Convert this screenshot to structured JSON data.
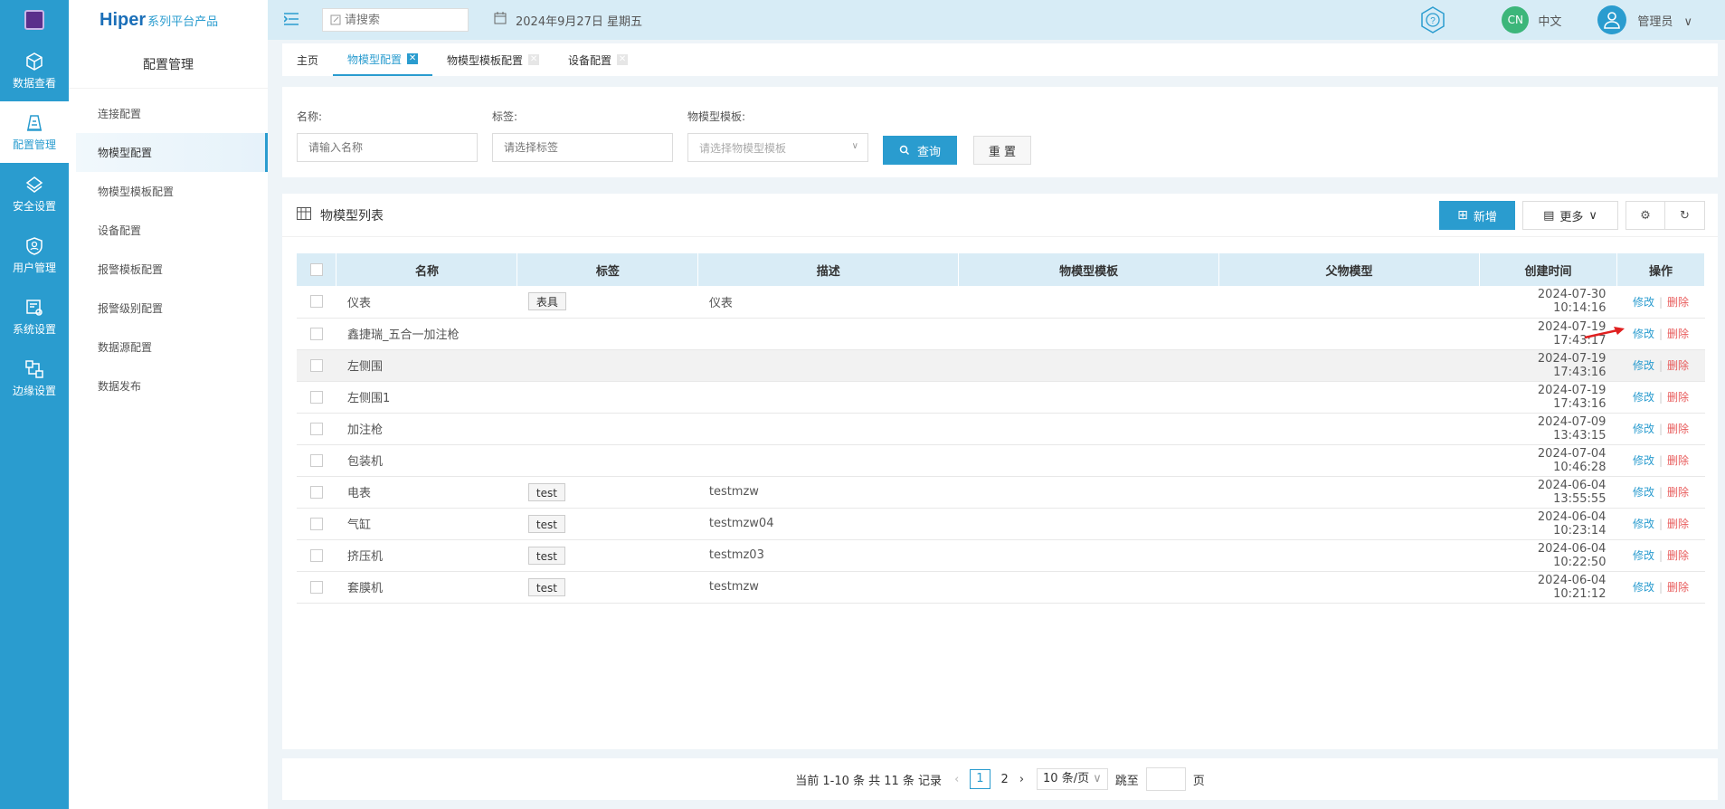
{
  "brand": {
    "name": "Hiper",
    "suffix": "系列平台产品"
  },
  "rail": [
    {
      "label": "数据查看",
      "icon": "cube-icon"
    },
    {
      "label": "配置管理",
      "icon": "config-icon"
    },
    {
      "label": "安全设置",
      "icon": "security-icon"
    },
    {
      "label": "用户管理",
      "icon": "user-shield-icon"
    },
    {
      "label": "系统设置",
      "icon": "system-settings-icon"
    },
    {
      "label": "边缘设置",
      "icon": "edge-icon"
    }
  ],
  "submenu": {
    "title": "配置管理",
    "items": [
      "连接配置",
      "物模型配置",
      "物模型模板配置",
      "设备配置",
      "报警模板配置",
      "报警级别配置",
      "数据源配置",
      "数据发布"
    ]
  },
  "topbar": {
    "search_placeholder": "请搜索",
    "date": "2024年9月27日 星期五",
    "lang_badge": "CN",
    "lang_text": "中文",
    "user": "管理员"
  },
  "tabs": [
    "主页",
    "物模型配置",
    "物模型模板配置",
    "设备配置"
  ],
  "filter": {
    "name_label": "名称:",
    "name_placeholder": "请输入名称",
    "tag_label": "标签:",
    "tag_placeholder": "请选择标签",
    "template_label": "物模型模板:",
    "template_placeholder": "请选择物模型模板",
    "query": "查询",
    "reset": "重 置"
  },
  "list": {
    "title": "物模型列表",
    "add": "新增",
    "more": "更多",
    "columns": [
      "名称",
      "标签",
      "描述",
      "物模型模板",
      "父物模型",
      "创建时间",
      "操作"
    ],
    "edit": "修改",
    "delete": "删除",
    "rows": [
      {
        "name": "仪表",
        "tag": "表具",
        "desc": "仪表",
        "template": "",
        "parent": "",
        "time": "2024-07-30 10:14:16"
      },
      {
        "name": "鑫捷瑞_五合一加注枪",
        "tag": "",
        "desc": "",
        "template": "",
        "parent": "",
        "time": "2024-07-19 17:43:17"
      },
      {
        "name": "左侧围",
        "tag": "",
        "desc": "",
        "template": "",
        "parent": "",
        "time": "2024-07-19 17:43:16"
      },
      {
        "name": "左侧围1",
        "tag": "",
        "desc": "",
        "template": "",
        "parent": "",
        "time": "2024-07-19 17:43:16"
      },
      {
        "name": "加注枪",
        "tag": "",
        "desc": "",
        "template": "",
        "parent": "",
        "time": "2024-07-09 13:43:15"
      },
      {
        "name": "包装机",
        "tag": "",
        "desc": "",
        "template": "",
        "parent": "",
        "time": "2024-07-04 10:46:28"
      },
      {
        "name": "电表",
        "tag": "test",
        "desc": "testmzw",
        "template": "",
        "parent": "",
        "time": "2024-06-04 13:55:55"
      },
      {
        "name": "气缸",
        "tag": "test",
        "desc": "testmzw04",
        "template": "",
        "parent": "",
        "time": "2024-06-04 10:23:14"
      },
      {
        "name": "挤压机",
        "tag": "test",
        "desc": "testmz03",
        "template": "",
        "parent": "",
        "time": "2024-06-04 10:22:50"
      },
      {
        "name": "套膜机",
        "tag": "test",
        "desc": "testmzw",
        "template": "",
        "parent": "",
        "time": "2024-06-04 10:21:12"
      }
    ]
  },
  "pager": {
    "summary": "当前 1-10 条 共 11 条 记录",
    "pages": [
      "1",
      "2"
    ],
    "current": "1",
    "size": "10 条/页",
    "jump_label": "跳至",
    "page_unit": "页"
  },
  "colors": {
    "primary": "#2a9ccf",
    "danger": "#e85c5c",
    "header_bg": "#d9ecf6"
  }
}
